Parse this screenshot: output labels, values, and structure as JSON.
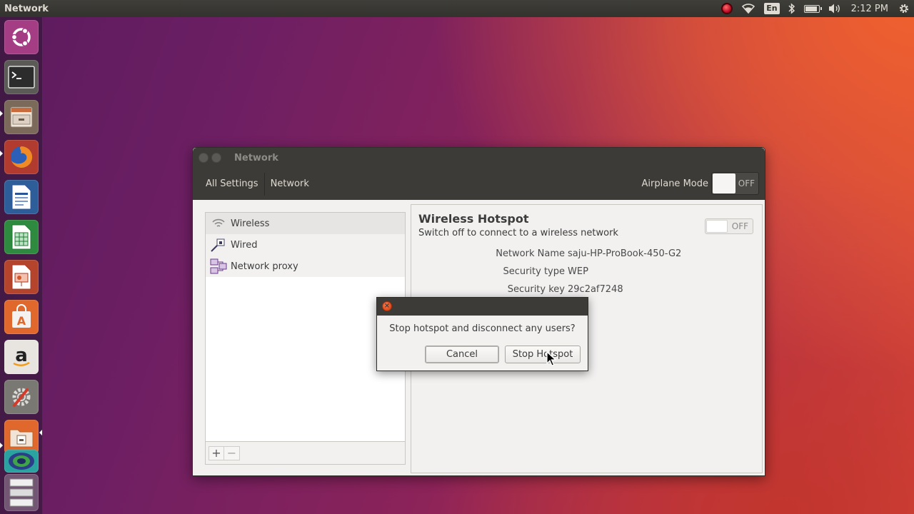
{
  "top_panel": {
    "app_title": "Network",
    "clock": "2:12 PM",
    "keyboard_layout": "En"
  },
  "launcher": {
    "items": [
      {
        "name": "ubuntu-dash",
        "icon": "ubuntu-logo-icon"
      },
      {
        "name": "terminal",
        "icon": "terminal-icon"
      },
      {
        "name": "files",
        "icon": "file-cabinet-icon"
      },
      {
        "name": "firefox",
        "icon": "firefox-icon"
      },
      {
        "name": "libreoffice-writer",
        "icon": "writer-document-icon"
      },
      {
        "name": "libreoffice-calc",
        "icon": "calc-spreadsheet-icon"
      },
      {
        "name": "libreoffice-impress",
        "icon": "impress-presentation-icon"
      },
      {
        "name": "ubuntu-software",
        "icon": "software-bag-icon"
      },
      {
        "name": "amazon",
        "icon": "amazon-icon"
      },
      {
        "name": "system-settings",
        "icon": "settings-wrench-gear-icon"
      },
      {
        "name": "file-manager",
        "icon": "folder-icon"
      },
      {
        "name": "network-settings",
        "icon": "network-globe-icon"
      },
      {
        "name": "workspaces",
        "icon": "workspace-switcher-icon"
      }
    ]
  },
  "window": {
    "title": "Network",
    "breadcrumbs": [
      "All Settings",
      "Network"
    ],
    "airplane_mode": {
      "label": "Airplane Mode",
      "state": "OFF"
    },
    "devices": [
      {
        "label": "Wireless",
        "icon": "wifi-icon",
        "selected": true
      },
      {
        "label": "Wired",
        "icon": "wired-network-icon",
        "selected": false
      },
      {
        "label": "Network proxy",
        "icon": "network-proxy-icon",
        "selected": false
      }
    ],
    "list_buttons": {
      "add": "+",
      "remove": "−"
    },
    "hotspot": {
      "title": "Wireless Hotspot",
      "subtitle": "Switch off to connect to a wireless network",
      "switch_state": "OFF",
      "fields": [
        {
          "key": "Network Name",
          "value": "saju-HP-ProBook-450-G2"
        },
        {
          "key": "Security type",
          "value": "WEP"
        },
        {
          "key": "Security key",
          "value": "29c2af7248"
        }
      ]
    }
  },
  "dialog": {
    "message": "Stop hotspot and disconnect any users?",
    "cancel_label": "Cancel",
    "stop_label": "Stop Hotspot"
  }
}
